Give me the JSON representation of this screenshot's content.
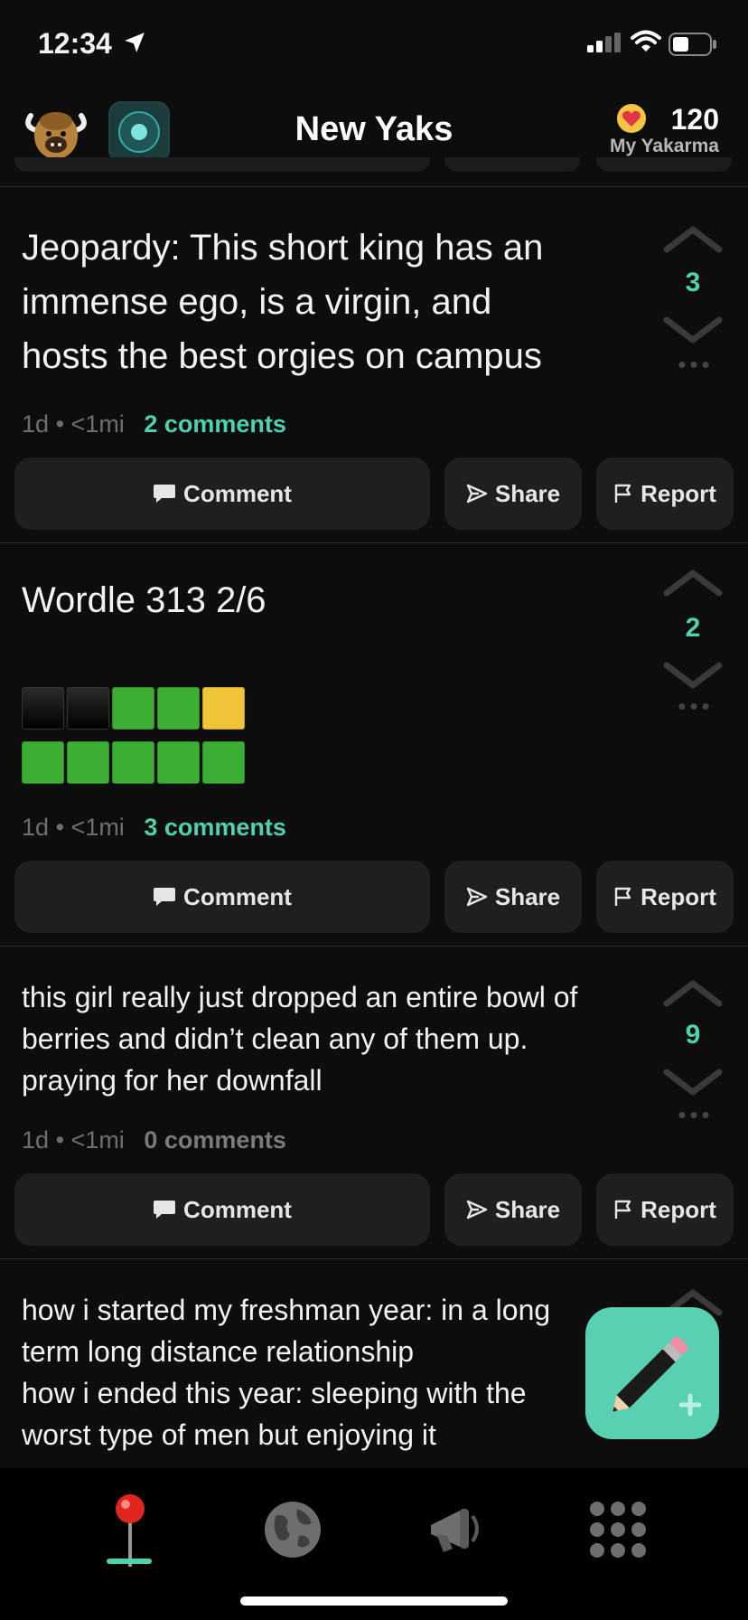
{
  "status": {
    "time": "12:34"
  },
  "header": {
    "title": "New Yaks",
    "karma": "120",
    "karma_label": "My Yakarma"
  },
  "posts": [
    {
      "text": "Jeopardy: This short king has an\nimmense ego, is a virgin, and\nhosts the best orgies on campus",
      "age": "1d",
      "distance": "<1mi",
      "comments": "2 comments",
      "votes": "3"
    },
    {
      "text": "Wordle 313 2/6",
      "age": "1d",
      "distance": "<1mi",
      "comments": "3 comments",
      "votes": "2",
      "wordle": [
        [
          "black",
          "black",
          "green",
          "green",
          "yellow"
        ],
        [
          "green",
          "green",
          "green",
          "green",
          "green"
        ]
      ]
    },
    {
      "text": "this girl really just dropped an entire bowl of\nberries and didn’t clean any of them up.\npraying for her downfall",
      "age": "1d",
      "distance": "<1mi",
      "comments": "0 comments",
      "votes": "9"
    },
    {
      "text": "how i started my freshman year: in a long\nterm long distance relationship\nhow i ended this year: sleeping with the\nworst type of men but enjoying it"
    }
  ],
  "actions": {
    "comment": "Comment",
    "share": "Share",
    "report": "Report"
  },
  "separator": "•",
  "colors": {
    "accent": "#4fd1ae",
    "fab": "#59d0b2",
    "background": "#0d0d0d",
    "button": "#1f1f1f"
  },
  "icons": {
    "tabs": [
      "pin-icon",
      "globe-icon",
      "megaphone-icon",
      "grid-icon"
    ],
    "fab": "pencil-plus-icon"
  }
}
